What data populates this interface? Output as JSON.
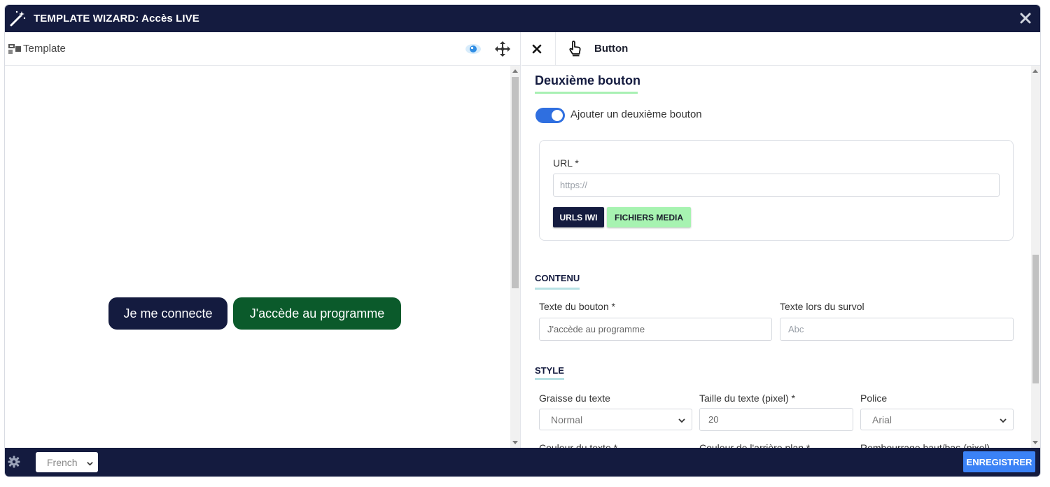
{
  "window": {
    "title": "TEMPLATE WIZARD: Accès LIVE"
  },
  "left_panel": {
    "header_label": "Template",
    "preview_buttons": {
      "primary": "Je me connecte",
      "secondary": "J'accède au programme"
    }
  },
  "right_panel": {
    "header_label": "Button",
    "section_title": "Deuxième bouton",
    "toggle_label": "Ajouter un deuxième bouton",
    "toggle_on": true,
    "url_card": {
      "label": "URL *",
      "placeholder": "https://",
      "btn_urls_iwi": "URLS IWI",
      "btn_media": "FICHIERS MEDIA"
    },
    "contenu": {
      "title": "CONTENU",
      "text_label": "Texte du bouton *",
      "text_value": "J'accède au programme",
      "hover_label": "Texte lors du survol",
      "hover_placeholder": "Abc"
    },
    "style": {
      "title": "STYLE",
      "weight_label": "Graisse du texte",
      "weight_value": "Normal",
      "size_label": "Taille du texte (pixel) *",
      "size_value": "20",
      "font_label": "Police",
      "font_value": "Arial",
      "color_label": "Couleur du texte *",
      "bg_label": "Couleur de l'arrière plan *",
      "padding_label": "Rembourrage haut/bas (pixel)"
    }
  },
  "footer": {
    "language": "French",
    "save_label": "ENREGISTRER"
  },
  "colors": {
    "navy": "#141b3f",
    "green_button": "#0b5a2b",
    "mint": "#a7f3b1",
    "blue": "#3b82f6",
    "toggle": "#2f6fe0"
  },
  "icons": [
    "magic-wand-icon",
    "close-icon",
    "template-icon",
    "eye-icon",
    "move-icon",
    "hand-pointer-icon",
    "gear-icon",
    "chevron-down-icon"
  ]
}
